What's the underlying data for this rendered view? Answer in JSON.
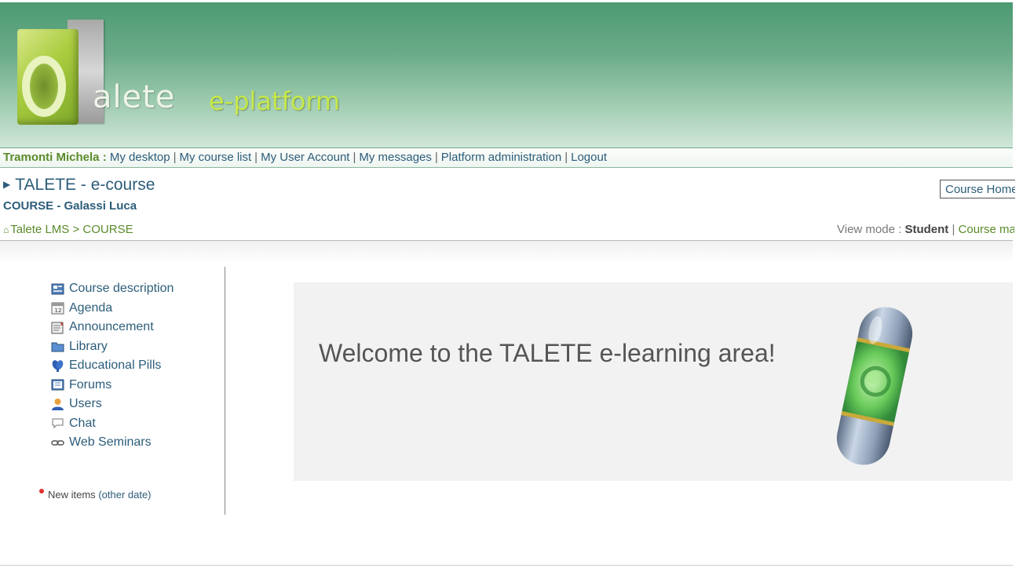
{
  "header": {
    "logo_text": "alete",
    "logo_sub": "e-platform"
  },
  "topnav": {
    "user": "Tramonti Michela :",
    "links": [
      "My desktop",
      "My course list",
      "My User Account",
      "My messages",
      "Platform administration",
      "Logout"
    ]
  },
  "course": {
    "title": "TALETE - e-course",
    "subtitle": "COURSE - Galassi Luca",
    "home_button": "Course Home"
  },
  "breadcrumb": {
    "root": "Talete LMS",
    "separator": ">",
    "current": "COURSE"
  },
  "view_mode": {
    "label": "View mode :",
    "current": "Student",
    "separator": "|",
    "other": "Course manager"
  },
  "sidebar": {
    "items": [
      {
        "label": "Course description",
        "icon": "course-description-icon",
        "color": "#3a6ea5"
      },
      {
        "label": "Agenda",
        "icon": "calendar-icon",
        "color": "#777777"
      },
      {
        "label": "Announcement",
        "icon": "announcement-icon",
        "color": "#666666"
      },
      {
        "label": "Library",
        "icon": "folder-icon",
        "color": "#3a6ea5"
      },
      {
        "label": "Educational Pills",
        "icon": "pills-icon",
        "color": "#2f5fb3"
      },
      {
        "label": "Forums",
        "icon": "forum-icon",
        "color": "#3a6ea5"
      },
      {
        "label": "Users",
        "icon": "user-icon",
        "color": "#d98c2b"
      },
      {
        "label": "Chat",
        "icon": "chat-icon",
        "color": "#888888"
      },
      {
        "label": "Web Seminars",
        "icon": "link-icon",
        "color": "#555555"
      }
    ],
    "legend_text": "New items",
    "legend_link": "(other date)"
  },
  "welcome": {
    "text": "Welcome to the TALETE e-learning area!"
  },
  "colors": {
    "banner": "#4c9a72",
    "link": "#2c5d7a",
    "accent_green": "#5b8b2a",
    "panel": "#f2f2f2"
  }
}
